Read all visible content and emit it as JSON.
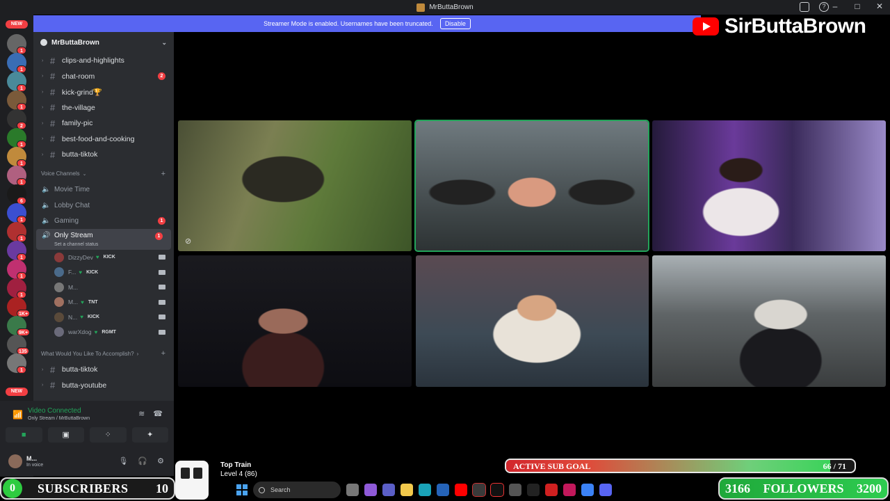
{
  "window": {
    "title": "MrButtaBrown"
  },
  "banner": {
    "text": "Streamer Mode is enabled. Usernames have been truncated.",
    "button": "Disable"
  },
  "overlay": {
    "youtube_name": "SirButtaBrown",
    "top_train": {
      "title": "Top Train",
      "level": "Level 4  (86)"
    },
    "sub_goal": {
      "label": "ACTIVE SUB GOAL",
      "current": 66,
      "target": 71,
      "count_text": "66 / 71"
    },
    "subscribers": {
      "current": "0",
      "label": "SUBSCRIBERS",
      "target": "10"
    },
    "followers": {
      "current": "3166",
      "label": "FOLLOWERS",
      "target": "3200"
    }
  },
  "rail": {
    "pill_top": "NEW",
    "pill_bottom": "NEW",
    "badges": [
      "1",
      "1",
      "1",
      "1",
      "2",
      "1",
      "1",
      "1",
      "6",
      "1",
      "1",
      "1",
      "1",
      "1",
      "1K+",
      "9K+",
      "135",
      "1"
    ]
  },
  "sidebar": {
    "server_name": "MrButtaBrown",
    "text_channels": [
      {
        "name": "clips-and-highlights",
        "badge": ""
      },
      {
        "name": "chat-room",
        "badge": "2"
      },
      {
        "name": "kick-grind🏆",
        "badge": ""
      },
      {
        "name": "the-village",
        "badge": ""
      },
      {
        "name": "family-pic",
        "badge": ""
      },
      {
        "name": "best-food-and-cooking",
        "badge": ""
      },
      {
        "name": "butta-tiktok",
        "badge": ""
      }
    ],
    "voice_category": "Voice Channels",
    "voice_channels": [
      {
        "name": "Movie Time",
        "badge": ""
      },
      {
        "name": "Lobby Chat",
        "badge": ""
      },
      {
        "name": "Gaming",
        "badge": "1"
      }
    ],
    "active_voice": {
      "name": "Only Stream",
      "badge": "1",
      "status": "Set a channel status"
    },
    "voice_users": [
      {
        "name": "DizzyDev",
        "tag": "KICK"
      },
      {
        "name": "F...",
        "tag": "KICK"
      },
      {
        "name": "M...",
        "tag": ""
      },
      {
        "name": "M...",
        "tag": "TNT"
      },
      {
        "name": "N...",
        "tag": "KICK"
      },
      {
        "name": "warXdog",
        "tag": "RGMT"
      }
    ],
    "category2": "What Would You Like To Accomplish?",
    "bottom_channels": [
      {
        "name": "butta-tiktok"
      },
      {
        "name": "butta-youtube"
      }
    ]
  },
  "voice_panel": {
    "title": "Video Connected",
    "subtitle": "Only Stream / MrButtaBrown"
  },
  "user_panel": {
    "name": "M...",
    "status": "In voice"
  },
  "taskbar": {
    "search_placeholder": "Search"
  },
  "colors": {
    "discord_blurple": "#5865f2",
    "online_green": "#23a55a",
    "badge_red": "#f23f43",
    "youtube_red": "#ff0000"
  }
}
